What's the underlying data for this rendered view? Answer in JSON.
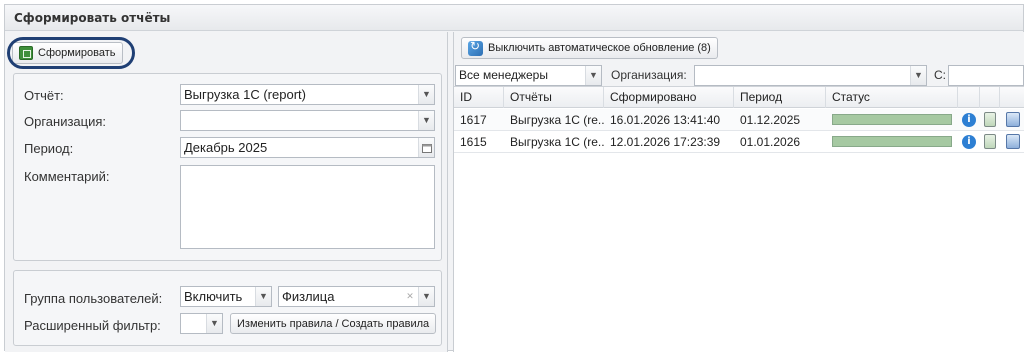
{
  "window": {
    "title": "Сформировать отчёты"
  },
  "left": {
    "build_button": "Сформировать",
    "report_label": "Отчёт:",
    "report_value": "Выгрузка 1С (report)",
    "org_label": "Организация:",
    "org_value": "",
    "period_label": "Период:",
    "period_value": "Декабрь 2025",
    "comment_label": "Комментарий:",
    "group_label": "Группа пользователей:",
    "group_mode": "Включить",
    "group_value": "Физлица",
    "adv_filter_label": "Расширенный фильтр:",
    "adv_filter_value": "",
    "rules_button": "Изменить правила / Создать правила"
  },
  "right": {
    "refresh_button": "Выключить автоматическое обновление (8)",
    "managers_filter": "Все менеджеры",
    "org_filter_label": "Организация:",
    "org_filter_value": "",
    "from_label": "С:",
    "columns": [
      "ID",
      "Отчёты",
      "Сформировано",
      "Период",
      "Статус"
    ],
    "rows": [
      {
        "id": "1617",
        "report": "Выгрузка 1С (re...",
        "created": "16.01.2026 13:41:40",
        "period": "01.12.2025",
        "progress": 1.0
      },
      {
        "id": "1615",
        "report": "Выгрузка 1С (re...",
        "created": "12.01.2026 17:23:39",
        "period": "01.01.2026",
        "progress": 1.0
      }
    ]
  },
  "icons": {
    "excel": "excel-icon",
    "refresh": "refresh-icon",
    "dropdown": "chevron-down-icon",
    "calendar": "calendar-icon",
    "clear": "clear-icon",
    "info": "info-icon",
    "delete": "trash-icon",
    "download": "save-icon"
  },
  "colors": {
    "progress_fill": "#a6c9a2",
    "info": "#2d7fd3",
    "highlight_ring": "#1f3f74"
  }
}
